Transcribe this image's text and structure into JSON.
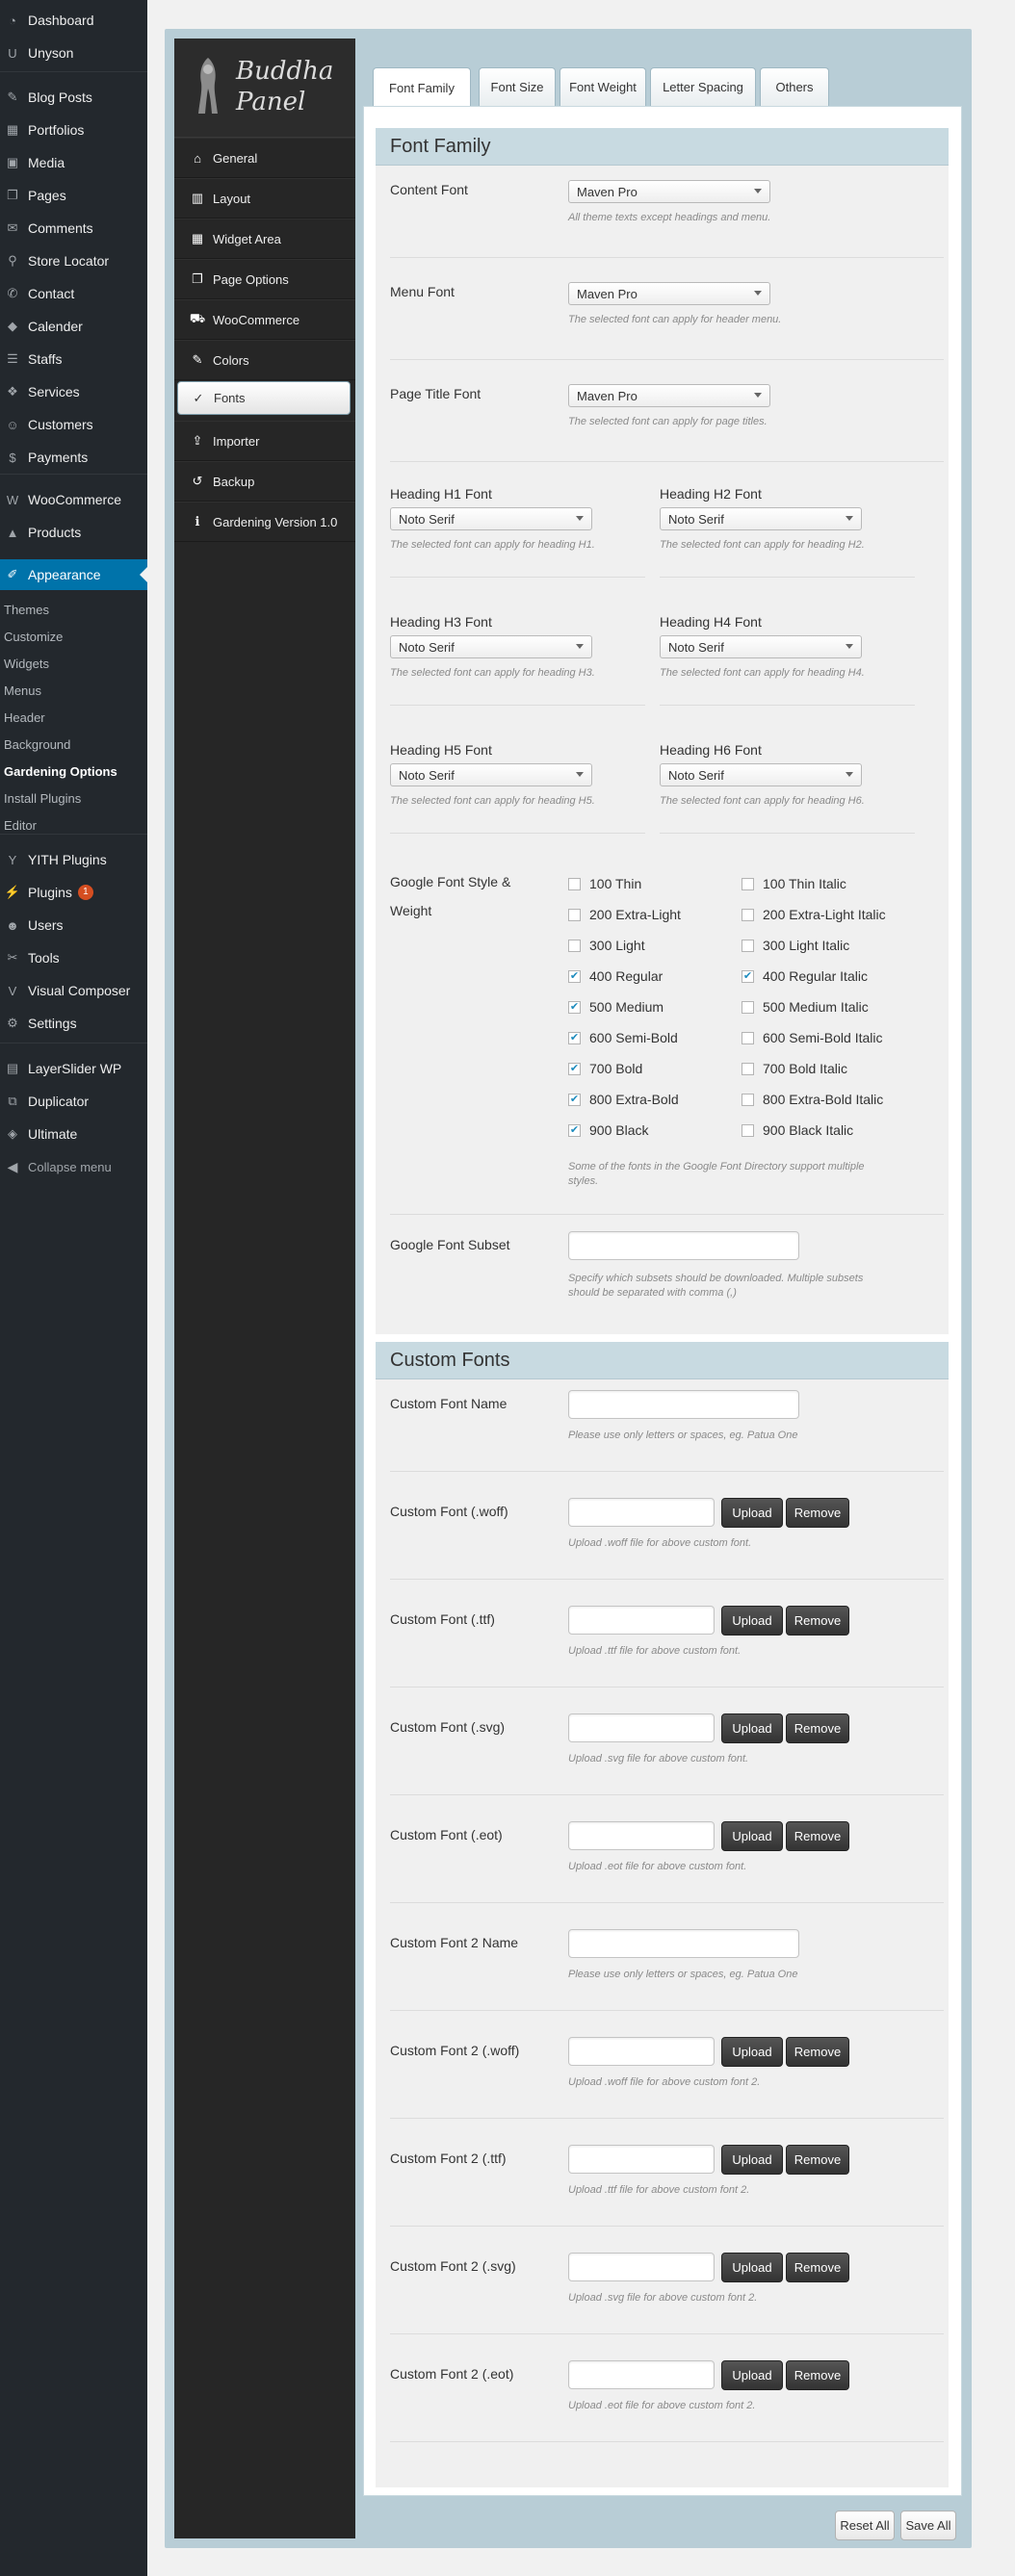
{
  "admin_menu": {
    "items": [
      {
        "label": "Dashboard",
        "icon": "dashboard-icon"
      },
      {
        "label": "Unyson",
        "icon": "unyson-icon"
      },
      {
        "label": "Blog Posts",
        "icon": "pin-icon"
      },
      {
        "label": "Portfolios",
        "icon": "portfolio-icon"
      },
      {
        "label": "Media",
        "icon": "media-icon"
      },
      {
        "label": "Pages",
        "icon": "pages-icon"
      },
      {
        "label": "Comments",
        "icon": "comments-icon"
      },
      {
        "label": "Store Locator",
        "icon": "location-icon"
      },
      {
        "label": "Contact",
        "icon": "contact-icon"
      },
      {
        "label": "Calender",
        "icon": "calendar-icon"
      },
      {
        "label": "Staffs",
        "icon": "staffs-icon"
      },
      {
        "label": "Services",
        "icon": "services-icon"
      },
      {
        "label": "Customers",
        "icon": "customers-icon"
      },
      {
        "label": "Payments",
        "icon": "payments-icon"
      },
      {
        "label": "WooCommerce",
        "icon": "woocommerce-icon"
      },
      {
        "label": "Products",
        "icon": "products-icon"
      },
      {
        "label": "Appearance",
        "icon": "appearance-icon"
      },
      {
        "label": "YITH Plugins",
        "icon": "yith-icon"
      },
      {
        "label": "Plugins",
        "icon": "plugins-icon",
        "badge": "1"
      },
      {
        "label": "Users",
        "icon": "users-icon"
      },
      {
        "label": "Tools",
        "icon": "tools-icon"
      },
      {
        "label": "Visual Composer",
        "icon": "visual-composer-icon"
      },
      {
        "label": "Settings",
        "icon": "settings-icon"
      },
      {
        "label": "LayerSlider WP",
        "icon": "layerslider-icon"
      },
      {
        "label": "Duplicator",
        "icon": "duplicator-icon"
      },
      {
        "label": "Ultimate",
        "icon": "ultimate-icon"
      }
    ],
    "appearance_sub": [
      "Themes",
      "Customize",
      "Widgets",
      "Menus",
      "Header",
      "Background",
      "Gardening Options",
      "Install Plugins",
      "Editor"
    ],
    "collapse_label": "Collapse menu"
  },
  "panel": {
    "logo_line1": "Buddha",
    "logo_line2": "Panel",
    "menu": [
      {
        "label": "General",
        "icon": "home-icon"
      },
      {
        "label": "Layout",
        "icon": "layout-icon"
      },
      {
        "label": "Widget Area",
        "icon": "widget-area-icon"
      },
      {
        "label": "Page Options",
        "icon": "page-options-icon"
      },
      {
        "label": "WooCommerce",
        "icon": "cart-icon"
      },
      {
        "label": "Colors",
        "icon": "brush-icon"
      },
      {
        "label": "Fonts",
        "icon": "spellcheck-icon"
      },
      {
        "label": "Importer",
        "icon": "upload-icon"
      },
      {
        "label": "Backup",
        "icon": "history-icon"
      },
      {
        "label": "Gardening Version 1.0",
        "icon": "info-icon"
      }
    ]
  },
  "tabs": [
    "Font Family",
    "Font Size",
    "Font Weight",
    "Letter Spacing",
    "Others"
  ],
  "font_family": {
    "title": "Font Family",
    "content_font": {
      "label": "Content Font",
      "value": "Maven Pro",
      "desc": "All theme texts except headings and menu."
    },
    "menu_font": {
      "label": "Menu Font",
      "value": "Maven Pro",
      "desc": "The selected font can apply for header menu."
    },
    "page_title_font": {
      "label": "Page Title Font",
      "value": "Maven Pro",
      "desc": "The selected font can apply for page titles."
    },
    "headings": [
      {
        "label": "Heading H1 Font",
        "value": "Noto Serif",
        "desc": "The selected font can apply for heading H1."
      },
      {
        "label": "Heading H2 Font",
        "value": "Noto Serif",
        "desc": "The selected font can apply for heading H2."
      },
      {
        "label": "Heading H3 Font",
        "value": "Noto Serif",
        "desc": "The selected font can apply for heading H3."
      },
      {
        "label": "Heading H4 Font",
        "value": "Noto Serif",
        "desc": "The selected font can apply for heading H4."
      },
      {
        "label": "Heading H5 Font",
        "value": "Noto Serif",
        "desc": "The selected font can apply for heading H5."
      },
      {
        "label": "Heading H6 Font",
        "value": "Noto Serif",
        "desc": "The selected font can apply for heading H6."
      }
    ],
    "style_weight": {
      "label_line1": "Google Font Style &",
      "label_line2": "Weight",
      "normal": [
        {
          "label": "100 Thin",
          "checked": false
        },
        {
          "label": "200 Extra-Light",
          "checked": false
        },
        {
          "label": "300 Light",
          "checked": false
        },
        {
          "label": "400 Regular",
          "checked": true
        },
        {
          "label": "500 Medium",
          "checked": true
        },
        {
          "label": "600 Semi-Bold",
          "checked": true
        },
        {
          "label": "700 Bold",
          "checked": true
        },
        {
          "label": "800 Extra-Bold",
          "checked": true
        },
        {
          "label": "900 Black",
          "checked": true
        }
      ],
      "italic": [
        {
          "label": "100 Thin Italic",
          "checked": false
        },
        {
          "label": "200 Extra-Light Italic",
          "checked": false
        },
        {
          "label": "300 Light Italic",
          "checked": false
        },
        {
          "label": "400 Regular Italic",
          "checked": true
        },
        {
          "label": "500 Medium Italic",
          "checked": false
        },
        {
          "label": "600 Semi-Bold Italic",
          "checked": false
        },
        {
          "label": "700 Bold Italic",
          "checked": false
        },
        {
          "label": "800 Extra-Bold Italic",
          "checked": false
        },
        {
          "label": "900 Black Italic",
          "checked": false
        }
      ],
      "desc_line1": "Some of the fonts in the Google Font Directory support multiple",
      "desc_line2": "styles."
    },
    "subset": {
      "label": "Google Font Subset",
      "value": "",
      "desc_line1": "Specify which subsets should be downloaded. Multiple subsets",
      "desc_line2": "should be separated with comma (,)"
    }
  },
  "custom_fonts": {
    "title": "Custom Fonts",
    "upload_label": "Upload",
    "remove_label": "Remove",
    "rows": [
      {
        "label": "Custom Font Name",
        "type": "name",
        "desc": "Please use only letters or spaces, eg. Patua One"
      },
      {
        "label": "Custom Font (.woff)",
        "type": "file",
        "desc": "Upload .woff file for above custom font."
      },
      {
        "label": "Custom Font (.ttf)",
        "type": "file",
        "desc": "Upload .ttf file for above custom font."
      },
      {
        "label": "Custom Font (.svg)",
        "type": "file",
        "desc": "Upload .svg file for above custom font."
      },
      {
        "label": "Custom Font (.eot)",
        "type": "file",
        "desc": "Upload .eot file for above custom font."
      },
      {
        "label": "Custom Font 2 Name",
        "type": "name",
        "desc": "Please use only letters or spaces, eg. Patua One"
      },
      {
        "label": "Custom Font 2 (.woff)",
        "type": "file",
        "desc": "Upload .woff file for above custom font 2."
      },
      {
        "label": "Custom Font 2 (.ttf)",
        "type": "file",
        "desc": "Upload .ttf file for above custom font 2."
      },
      {
        "label": "Custom Font 2 (.svg)",
        "type": "file",
        "desc": "Upload .svg file for above custom font 2."
      },
      {
        "label": "Custom Font 2 (.eot)",
        "type": "file",
        "desc": "Upload .eot file for above custom font 2."
      }
    ]
  },
  "footer": {
    "reset_label": "Reset All",
    "save_label": "Save All"
  },
  "colors": {
    "admin_bg": "#23282d",
    "accent": "#0073aa",
    "badge": "#d54e21",
    "panel_frame": "#b8cdd6",
    "section_head": "#c8dae1"
  }
}
